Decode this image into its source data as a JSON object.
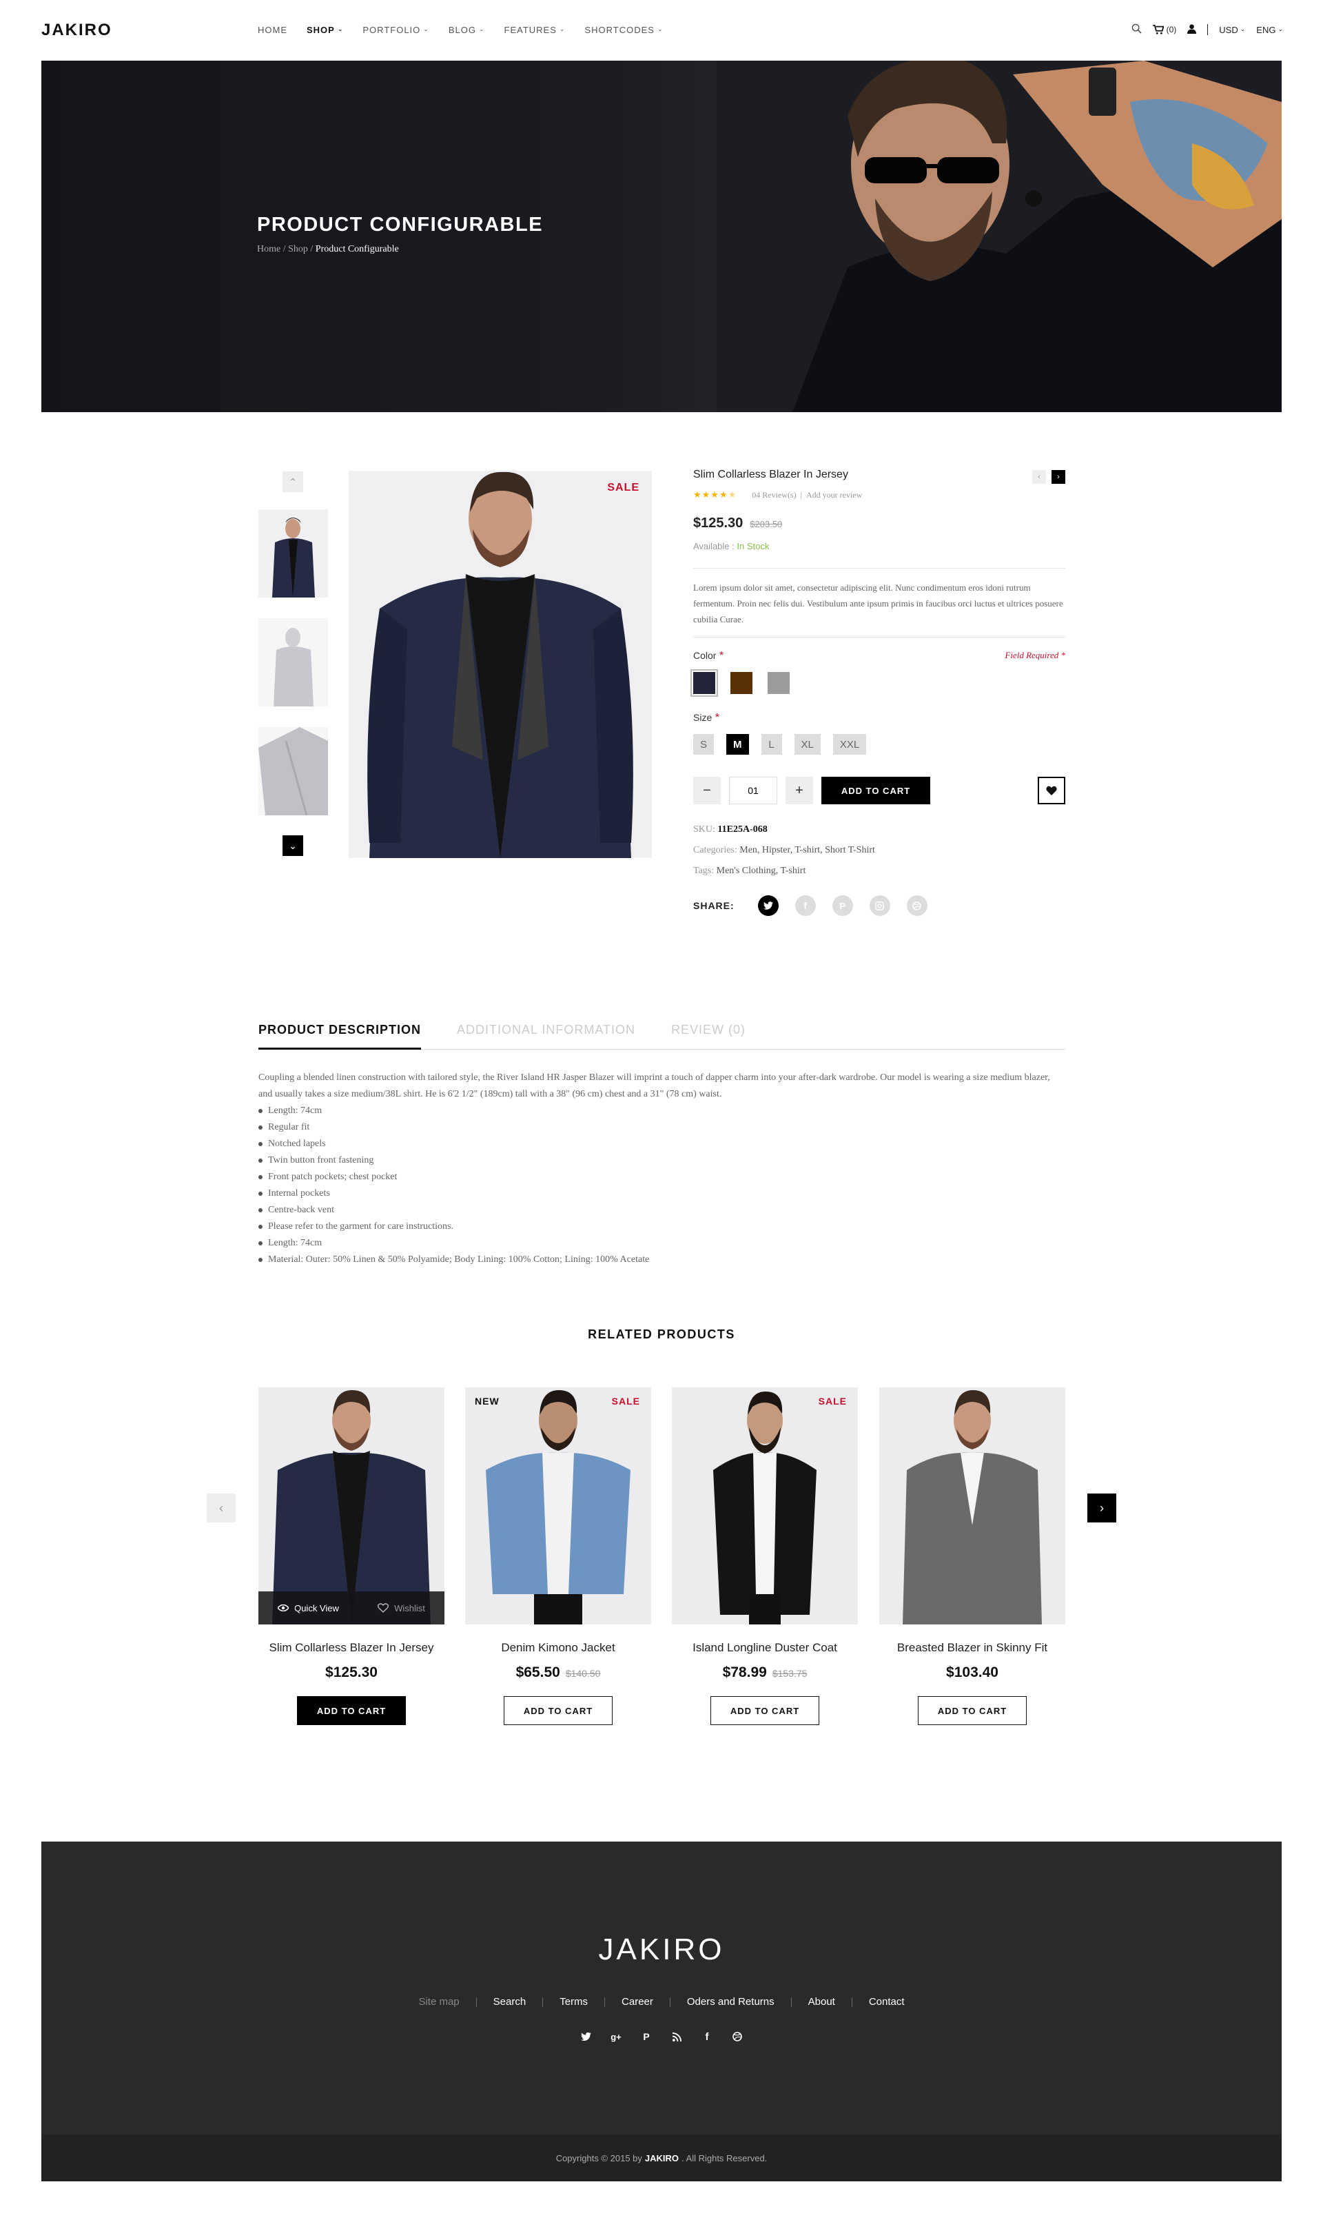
{
  "header": {
    "logo": "JAKIRO",
    "nav": [
      {
        "label": "HOME",
        "dropdown": false
      },
      {
        "label": "SHOP",
        "dropdown": true,
        "active": true
      },
      {
        "label": "PORTFOLIO",
        "dropdown": true
      },
      {
        "label": "BLOG",
        "dropdown": true
      },
      {
        "label": "FEATURES",
        "dropdown": true
      },
      {
        "label": "SHORTCODES",
        "dropdown": true
      }
    ],
    "cart_count": "(0)",
    "currency": "USD",
    "language": "ENG"
  },
  "hero": {
    "title": "PRODUCT CONFIGURABLE",
    "breadcrumb": {
      "home": "Home",
      "sep": "/",
      "shop": "Shop",
      "current": "Product Configurable"
    }
  },
  "product": {
    "sale_badge": "SALE",
    "title": "Slim Collarless Blazer In Jersey",
    "rating": 4.5,
    "reviews": "04 Review(s)",
    "review_sep": "|",
    "add_review": "Add your review",
    "price": "$125.30",
    "old_price": "$203.50",
    "availability_label": "Available :",
    "availability_value": "In Stock",
    "description": "Lorem ipsum dolor sit amet, consectetur adipiscing elit. Nunc condimentum eros idoni rutrum fermentum. Proin nec felis dui. Vestibulum ante ipsum primis in faucibus orci luctus et ultrices posuere cubilia Curae.",
    "color_label": "Color",
    "required_mark": "*",
    "field_required": "Field Required *",
    "colors": [
      "#23243a",
      "#5a3106",
      "#9b9b9b"
    ],
    "size_label": "Size",
    "sizes": [
      {
        "label": "S",
        "selected": false
      },
      {
        "label": "M",
        "selected": true
      },
      {
        "label": "L",
        "selected": false
      },
      {
        "label": "XL",
        "selected": false
      },
      {
        "label": "XXL",
        "selected": false
      }
    ],
    "qty_minus": "−",
    "qty_plus": "+",
    "quantity": "01",
    "add_to_cart": "ADD TO CART",
    "sku_label": "SKU:",
    "sku": "11E25A-068",
    "categories_label": "Categories:",
    "categories": "Men, Hipster, T-shirt, Short T-Shirt",
    "tags_label": "Tags:",
    "tags": "Men's Clothing, T-shirt",
    "share_label": "SHARE:"
  },
  "tabs": {
    "items": [
      {
        "label": "PRODUCT DESCRIPTION",
        "active": true
      },
      {
        "label": "ADDITIONAL INFORMATION",
        "active": false
      },
      {
        "label": "REVIEW (0)",
        "active": false
      }
    ],
    "intro": "Coupling a blended linen construction with tailored style, the River Island HR Jasper Blazer will imprint a touch of dapper charm into your after-dark wardrobe. Our model is wearing a size medium blazer, and usually takes a size medium/38L shirt. He is 6'2 1/2\" (189cm) tall with a 38\" (96 cm) chest and a 31\" (78 cm) waist.",
    "bullets": [
      "Length: 74cm",
      "Regular fit",
      "Notched lapels",
      "Twin button front fastening",
      "Front patch pockets; chest pocket",
      "Internal pockets",
      "Centre-back vent",
      "Please refer to the garment for care instructions.",
      "Length: 74cm",
      "Material: Outer: 50% Linen & 50% Polyamide; Body Lining: 100% Cotton; Lining: 100% Acetate"
    ]
  },
  "related": {
    "title": "RELATED PRODUCTS",
    "quick_view": "Quick View",
    "wishlist": "Wishlist",
    "items": [
      {
        "name": "Slim Collarless Blazer In Jersey",
        "price": "$125.30",
        "old_price": "",
        "badge_left": "",
        "badge_right": "",
        "button": "ADD TO CART",
        "garment": "#262b45"
      },
      {
        "name": "Denim Kimono Jacket",
        "price": "$65.50",
        "old_price": "$140.50",
        "badge_left": "NEW",
        "badge_right": "SALE",
        "button": "ADD TO CART",
        "garment": "#6d95c3"
      },
      {
        "name": "Island Longline Duster Coat",
        "price": "$78.99",
        "old_price": "$153.75",
        "badge_left": "",
        "badge_right": "SALE",
        "button": "ADD TO CART",
        "garment": "#141414"
      },
      {
        "name": "Breasted Blazer in Skinny Fit",
        "price": "$103.40",
        "old_price": "",
        "badge_left": "",
        "badge_right": "",
        "button": "ADD TO CART",
        "garment": "#6a6a6a"
      }
    ]
  },
  "footer": {
    "logo": "JAKIRO",
    "links": [
      "Site map",
      "Search",
      "Terms",
      "Career",
      "Oders and Returns",
      "About",
      "Contact"
    ],
    "social_icons": [
      "twitter-icon",
      "google-plus-icon",
      "pinterest-icon",
      "rss-icon",
      "facebook-icon",
      "dribbble-icon"
    ],
    "copyright_pre": "Copyrights © 2015 by",
    "copyright_brand": "JAKIRO",
    "copyright_post": ". All Rights Reserved."
  }
}
